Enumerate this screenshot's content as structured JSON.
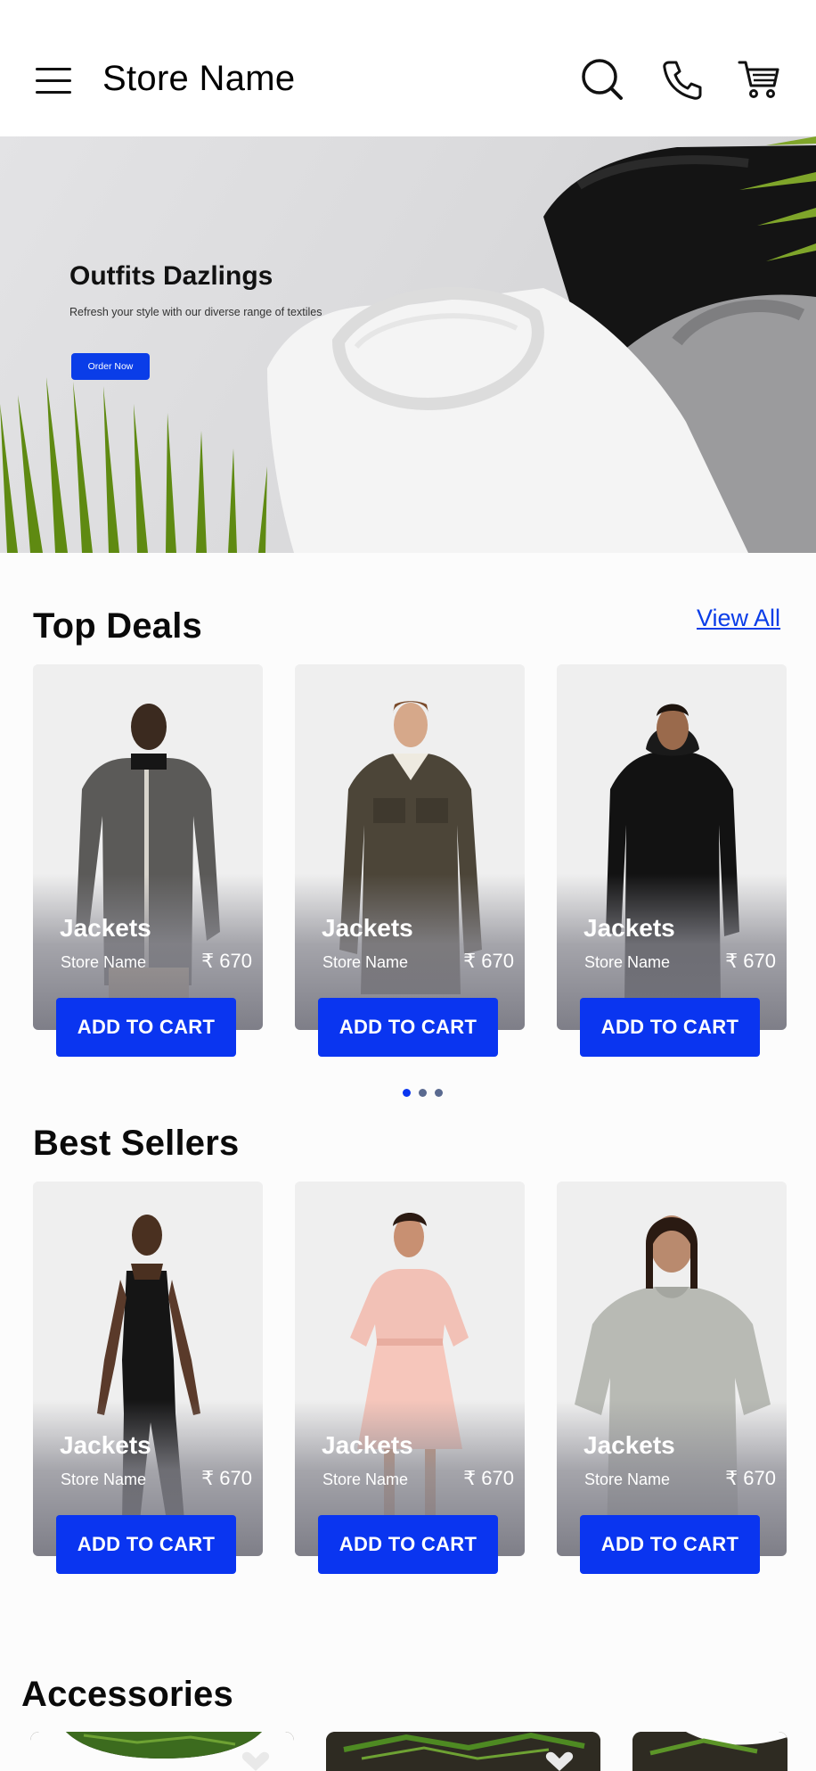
{
  "header": {
    "store_name": "Store Name",
    "icons": [
      "menu-icon",
      "search-icon",
      "phone-icon",
      "cart-icon"
    ]
  },
  "hero": {
    "title": "Outfits Dazlings",
    "subtitle": "Refresh your style with our diverse range of textiles",
    "cta_label": "Order Now"
  },
  "top_deals": {
    "title": "Top Deals",
    "view_all": "View All",
    "products": [
      {
        "name": "Jackets",
        "store": "Store Name",
        "price": "₹ 670",
        "button": "ADD TO CART"
      },
      {
        "name": "Jackets",
        "store": "Store Name",
        "price": "₹ 670",
        "button": "ADD TO CART"
      },
      {
        "name": "Jackets",
        "store": "Store Name",
        "price": "₹ 670",
        "button": "ADD TO CART"
      }
    ],
    "page_dots": 3,
    "active_dot": 0
  },
  "best_sellers": {
    "title": "Best Sellers",
    "products": [
      {
        "name": "Jackets",
        "store": "Store Name",
        "price": "₹ 670",
        "button": "ADD TO CART"
      },
      {
        "name": "Jackets",
        "store": "Store Name",
        "price": "₹ 670",
        "button": "ADD TO CART"
      },
      {
        "name": "Jackets",
        "store": "Store Name",
        "price": "₹ 670",
        "button": "ADD TO CART"
      }
    ]
  },
  "accessories": {
    "title": "Accessories"
  },
  "colors": {
    "accent": "#0a35f0",
    "link": "#0a3de8",
    "dot_active": "#0a35f0",
    "dot_inactive": "#5a6a90"
  }
}
